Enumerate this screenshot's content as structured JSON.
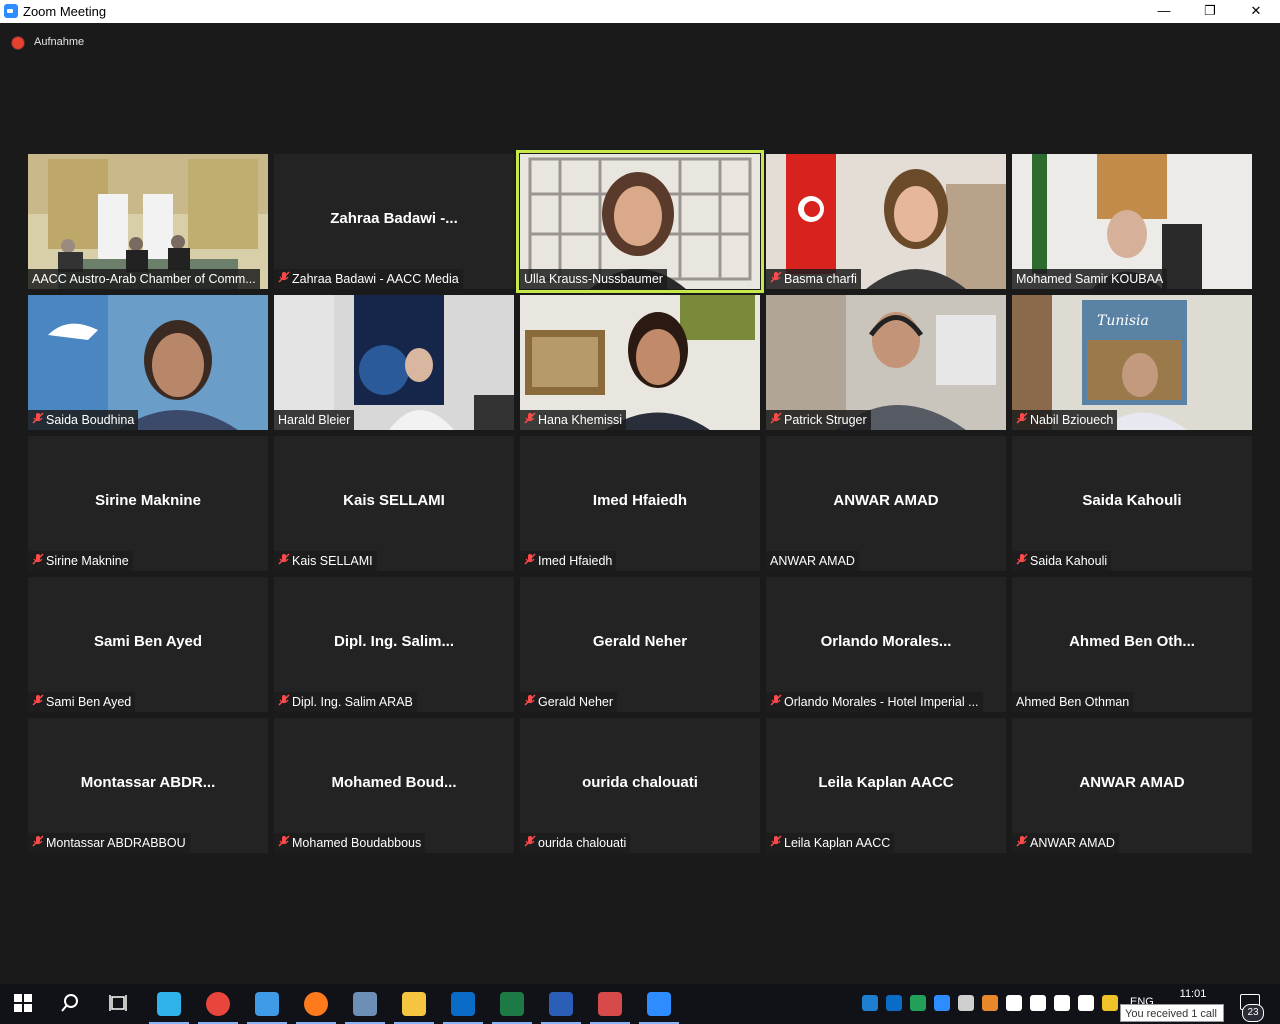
{
  "window": {
    "title": "Zoom Meeting",
    "minimize": "—",
    "restore": "❐",
    "close": "✕"
  },
  "recording": {
    "label": "Aufnahme"
  },
  "tiles": [
    {
      "name": "AACC Austro-Arab Chamber of Comm...",
      "big": "",
      "muted": false,
      "video": true,
      "scene": "room"
    },
    {
      "name": "Zahraa Badawi - AACC Media",
      "big": "Zahraa Badawi -...",
      "muted": true,
      "video": false
    },
    {
      "name": "Ulla Krauss-Nussbaumer",
      "big": "",
      "muted": false,
      "video": true,
      "active": true,
      "scene": "window"
    },
    {
      "name": "Basma charfi",
      "big": "",
      "muted": true,
      "video": true,
      "scene": "flag"
    },
    {
      "name": "Mohamed Samir KOUBAA",
      "big": "",
      "muted": false,
      "video": true,
      "scene": "office"
    },
    {
      "name": "Saida Boudhina",
      "big": "",
      "muted": true,
      "video": true,
      "scene": "blue"
    },
    {
      "name": "Harald Bleier",
      "big": "",
      "muted": false,
      "video": true,
      "scene": "poster"
    },
    {
      "name": "Hana Khemissi",
      "big": "",
      "muted": true,
      "video": true,
      "scene": "painting"
    },
    {
      "name": "Patrick Struger",
      "big": "",
      "muted": true,
      "video": true,
      "scene": "headset"
    },
    {
      "name": "Nabil Bziouech",
      "big": "",
      "muted": true,
      "video": true,
      "scene": "tunisia"
    },
    {
      "name": "Sirine Maknine",
      "big": "Sirine Maknine",
      "muted": true,
      "video": false
    },
    {
      "name": "Kais SELLAMI",
      "big": "Kais SELLAMI",
      "muted": true,
      "video": false
    },
    {
      "name": "Imed Hfaiedh",
      "big": "Imed Hfaiedh",
      "muted": true,
      "video": false
    },
    {
      "name": "ANWAR AMAD",
      "big": "ANWAR AMAD",
      "muted": false,
      "video": false
    },
    {
      "name": "Saida Kahouli",
      "big": "Saida Kahouli",
      "muted": true,
      "video": false
    },
    {
      "name": "Sami Ben Ayed",
      "big": "Sami Ben Ayed",
      "muted": true,
      "video": false
    },
    {
      "name": "Dipl. Ing. Salim ARAB",
      "big": "Dipl.  Ing.  Salim...",
      "muted": true,
      "video": false
    },
    {
      "name": "Gerald Neher",
      "big": "Gerald Neher",
      "muted": true,
      "video": false
    },
    {
      "name": "Orlando Morales - Hotel Imperial ...",
      "big": "Orlando  Morales...",
      "muted": true,
      "video": false
    },
    {
      "name": "Ahmed Ben Othman",
      "big": "Ahmed  Ben  Oth...",
      "muted": false,
      "video": false
    },
    {
      "name": "Montassar ABDRABBOU",
      "big": "Montassar  ABDR...",
      "muted": true,
      "video": false
    },
    {
      "name": "Mohamed Boudabbous",
      "big": "Mohamed  Boud...",
      "muted": true,
      "video": false
    },
    {
      "name": "ourida chalouati",
      "big": "ourida chalouati",
      "muted": true,
      "video": false
    },
    {
      "name": "Leila Kaplan AACC",
      "big": "Leila Kaplan AACC",
      "muted": true,
      "video": false
    },
    {
      "name": "ANWAR AMAD",
      "big": "ANWAR AMAD",
      "muted": true,
      "video": false
    }
  ],
  "taskbar": {
    "apps": [
      {
        "icon": "windows-start-icon",
        "color": "#ffffff"
      },
      {
        "icon": "search-icon",
        "color": "#ffffff"
      },
      {
        "icon": "task-view-icon",
        "color": "#ffffff"
      },
      {
        "icon": "edge-icon",
        "color": "#2fb3e8"
      },
      {
        "icon": "chrome-icon",
        "color": "#e8453c"
      },
      {
        "icon": "ie-icon",
        "color": "#3f9be5"
      },
      {
        "icon": "firefox-icon",
        "color": "#ff7a1a"
      },
      {
        "icon": "network-app-icon",
        "color": "#6e8fb5"
      },
      {
        "icon": "file-explorer-icon",
        "color": "#f5c542"
      },
      {
        "icon": "outlook-icon",
        "color": "#0a6cc7"
      },
      {
        "icon": "excel-icon",
        "color": "#1d7a45"
      },
      {
        "icon": "word-icon",
        "color": "#2b5eb6"
      },
      {
        "icon": "paint-icon",
        "color": "#d64a4a"
      },
      {
        "icon": "zoom-icon",
        "color": "#2d8cff"
      }
    ],
    "tray_icons": [
      "lync-icon",
      "outlook-tray-icon",
      "shield-check-icon",
      "zoom-tray-icon",
      "webcam-icon",
      "orange-app-icon",
      "defender-icon",
      "network-icon",
      "usb-icon",
      "volume-icon",
      "alert-icon"
    ],
    "language": "ENG",
    "time": "11:01",
    "toast": "You received 1 call",
    "notification_count": "23"
  }
}
